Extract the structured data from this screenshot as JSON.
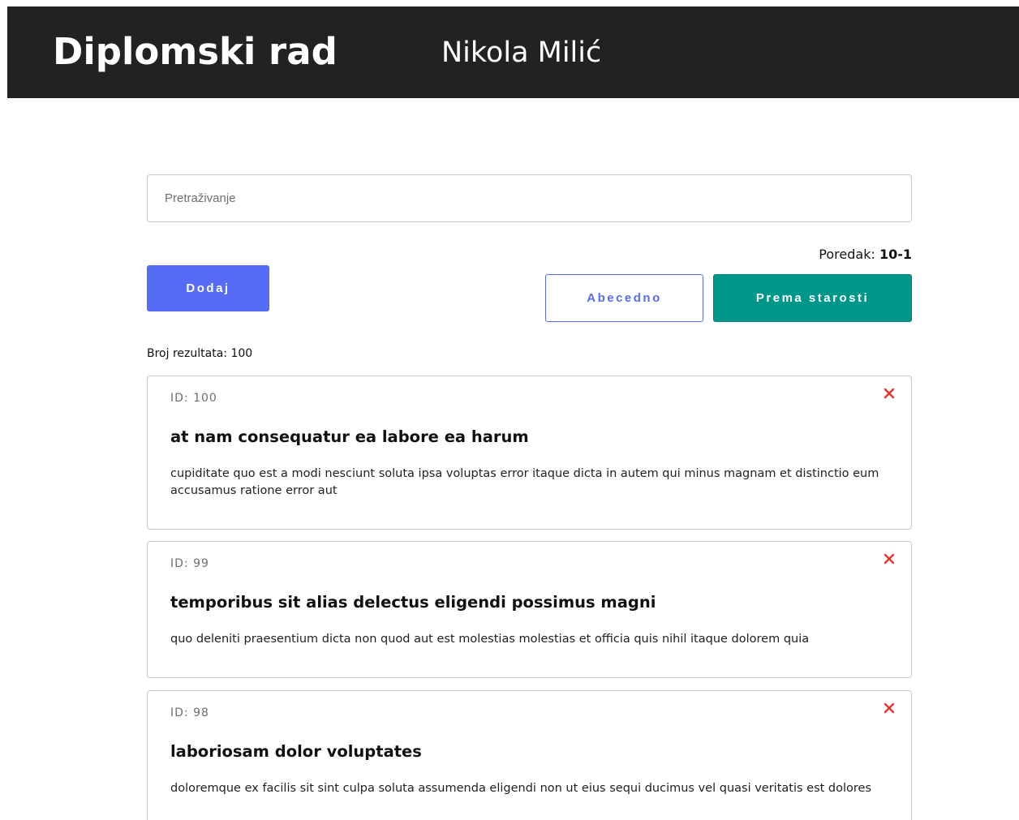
{
  "header": {
    "title": "Diplomski rad",
    "author": "Nikola Milić"
  },
  "search": {
    "placeholder": "Pretraživanje",
    "value": ""
  },
  "order": {
    "label": "Poredak:",
    "value": "10-1"
  },
  "buttons": {
    "add": "Dodaj",
    "alphabetical": "Abecedno",
    "by_age": "Prema starosti"
  },
  "results": {
    "label": "Broj rezultata:",
    "count": "100"
  },
  "posts": [
    {
      "id_label": "ID: 100",
      "title": "at nam consequatur ea labore ea harum",
      "body": "cupiditate quo est a modi nesciunt soluta ipsa voluptas error itaque dicta in autem qui minus magnam et distinctio eum accusamus ratione error aut",
      "delete_icon": "close-icon"
    },
    {
      "id_label": "ID: 99",
      "title": "temporibus sit alias delectus eligendi possimus magni",
      "body": "quo deleniti praesentium dicta non quod aut est molestias molestias et officia quis nihil itaque dolorem quia",
      "delete_icon": "close-icon"
    },
    {
      "id_label": "ID: 98",
      "title": "laboriosam dolor voluptates",
      "body": "doloremque ex facilis sit sint culpa soluta assumenda eligendi non ut eius sequi ducimus vel quasi veritatis est dolores",
      "delete_icon": "close-icon"
    }
  ],
  "colors": {
    "header_bg": "#222222",
    "primary": "#566cf5",
    "teal": "#00968a",
    "delete": "#e5352c"
  }
}
